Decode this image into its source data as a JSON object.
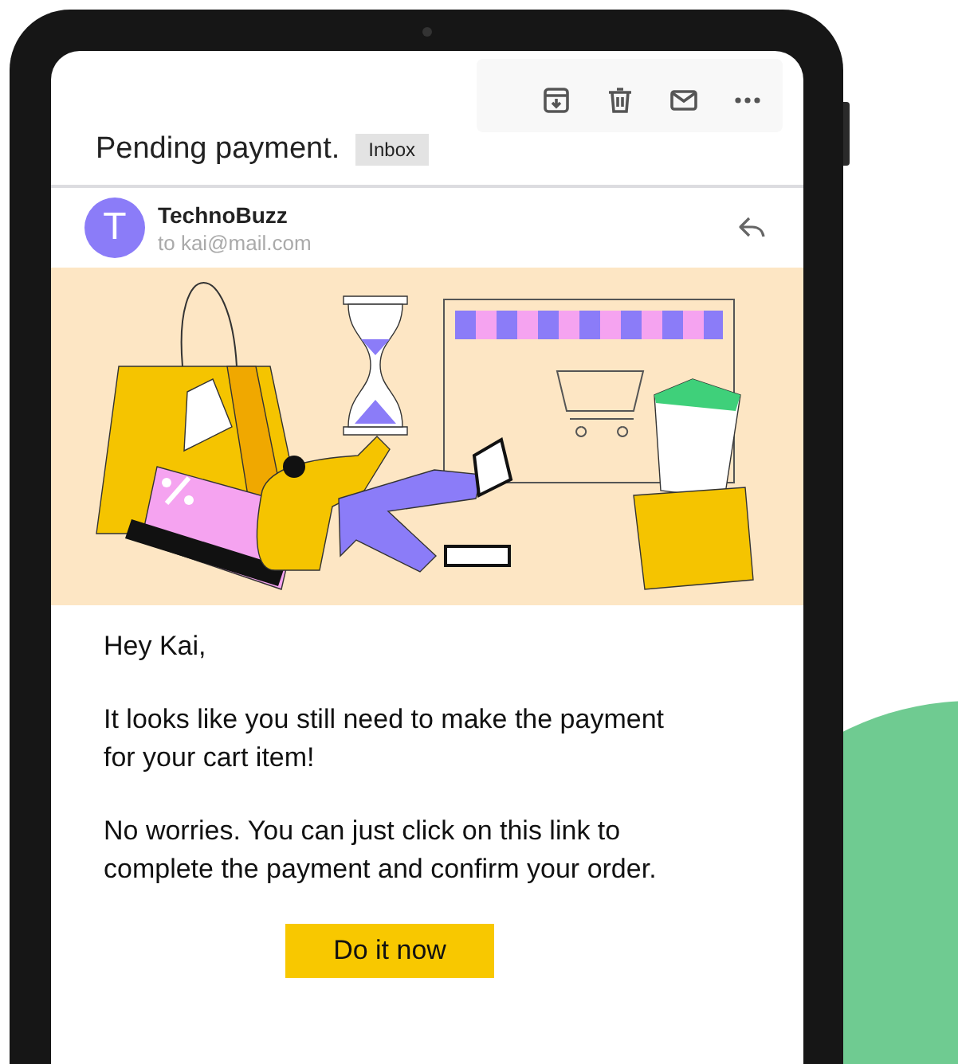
{
  "email": {
    "subject": "Pending payment.",
    "label": "Inbox",
    "sender": {
      "initial": "T",
      "name": "TechnoBuzz",
      "to": "to kai@mail.com"
    },
    "body": [
      "Hey Kai,",
      "It looks like you still need to make the payment for your cart item!",
      "No worries. You can just click on this link to complete the payment and confirm your order."
    ],
    "button": "Do it now"
  }
}
